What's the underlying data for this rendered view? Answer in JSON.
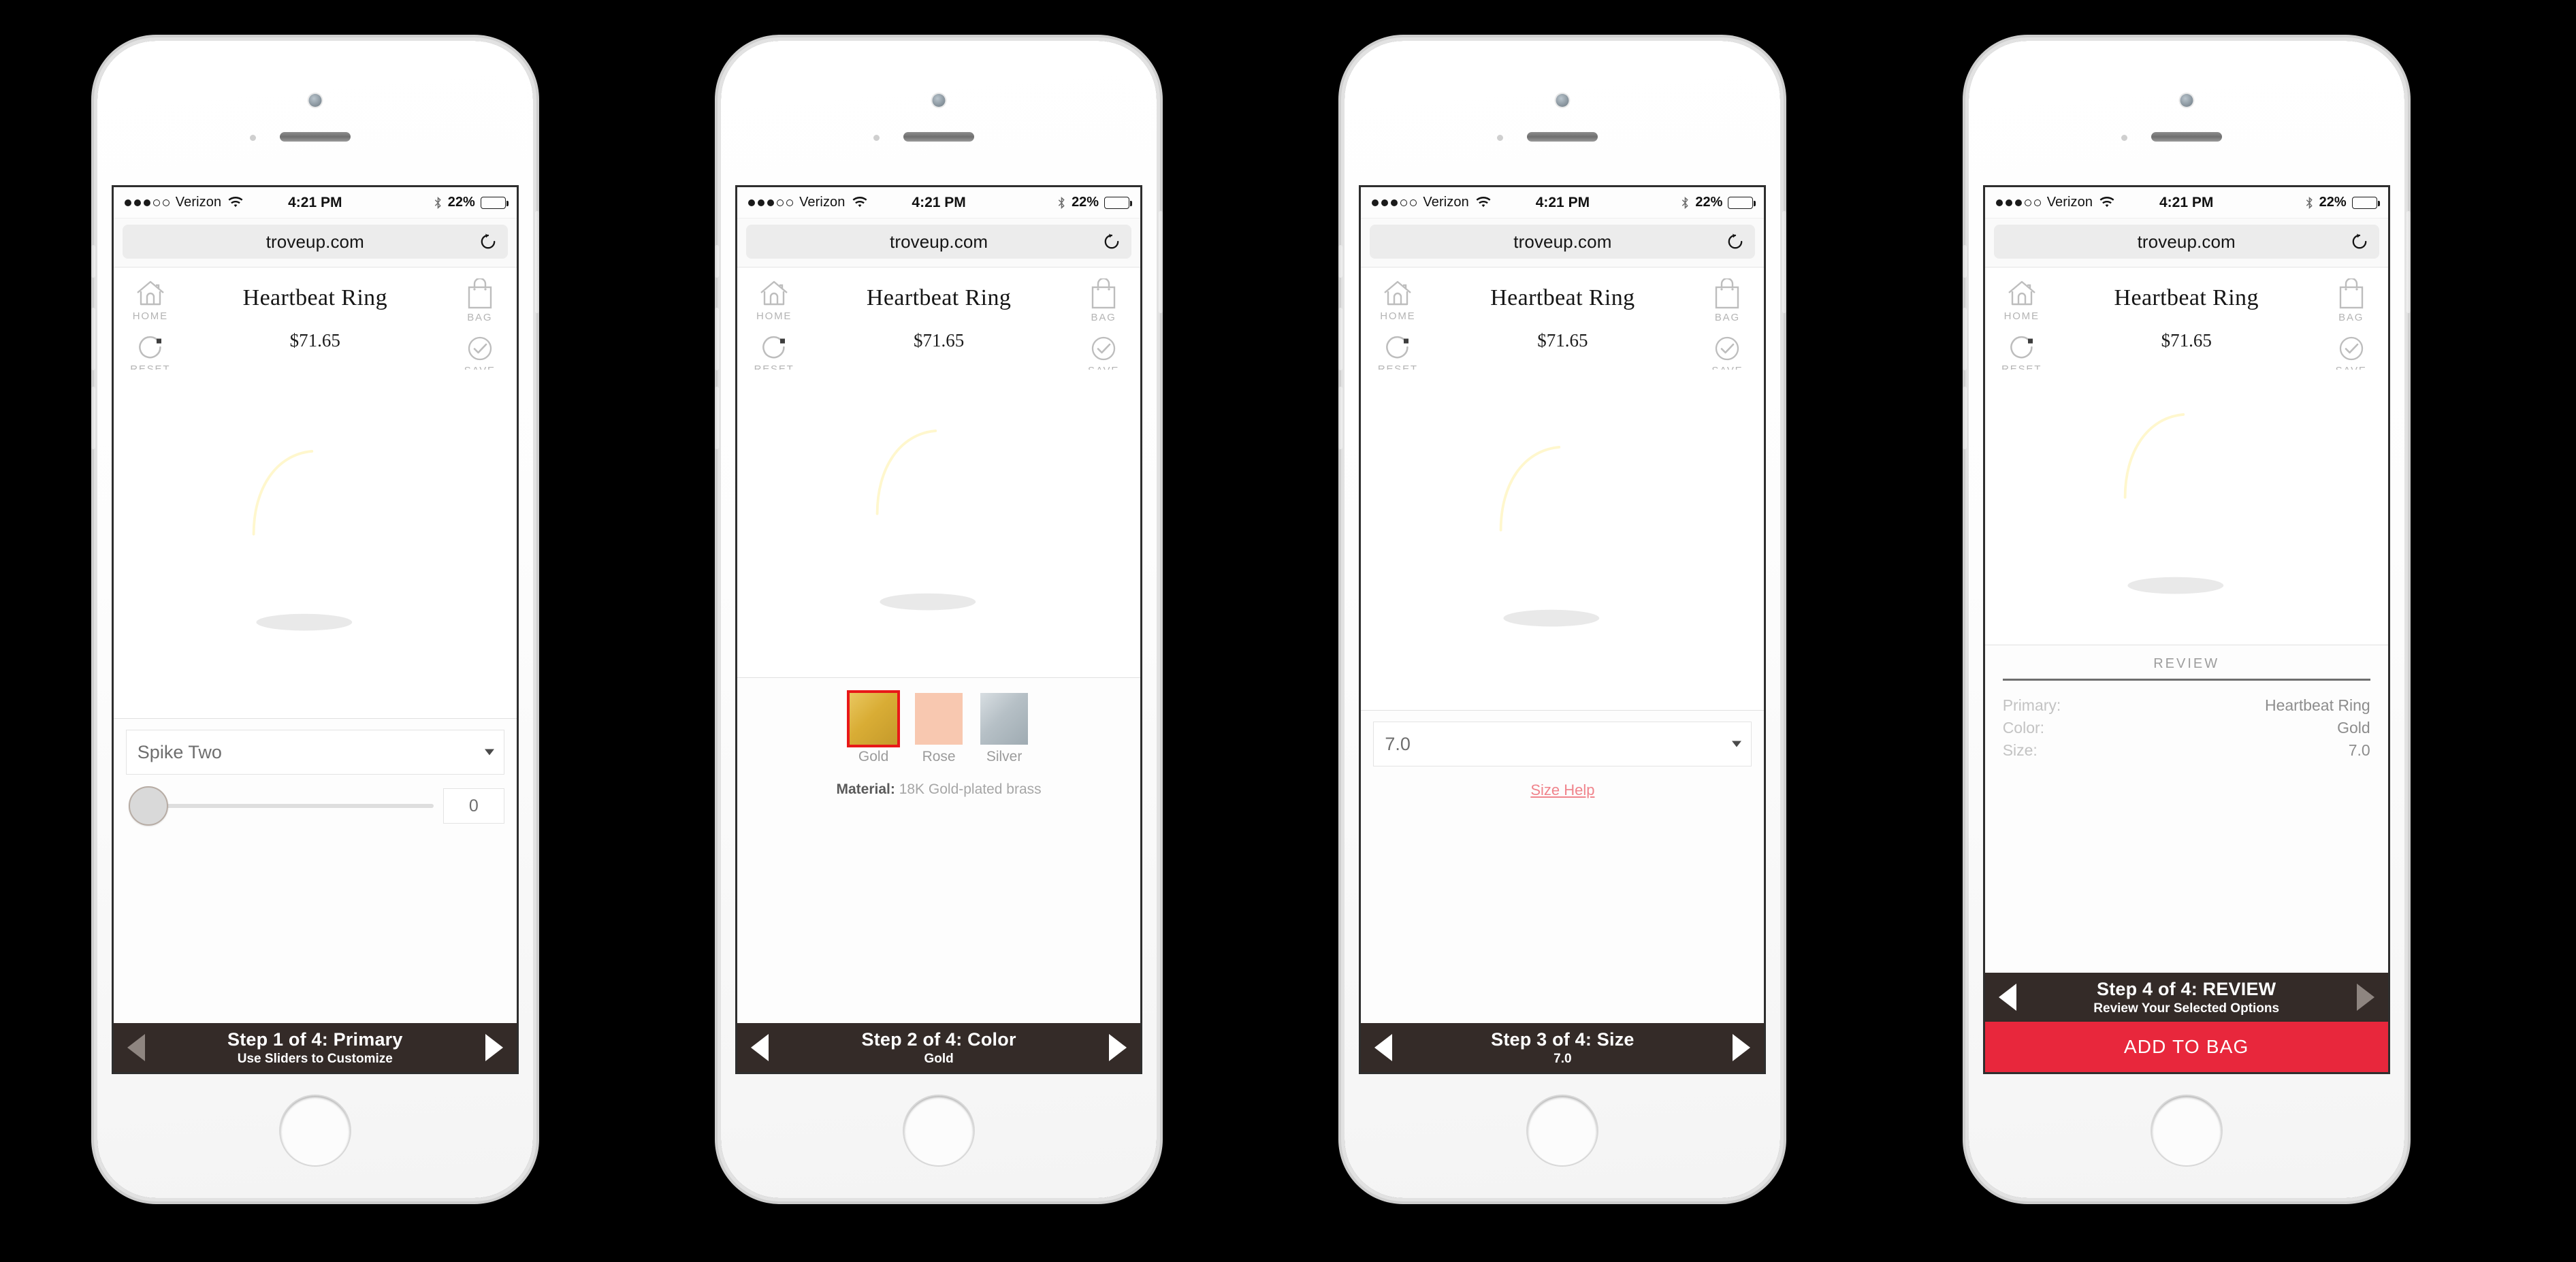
{
  "status_bar": {
    "carrier": "Verizon",
    "signal_dots_filled": 3,
    "signal_dots_total": 5,
    "time": "4:21 PM",
    "battery_percent": "22%",
    "battery_level": 22,
    "bluetooth": true,
    "wifi": true
  },
  "browser": {
    "url": "troveup.com",
    "reload_label": "Reload"
  },
  "app": {
    "home_label": "HOME",
    "bag_label": "BAG",
    "reset_label": "RESET",
    "save_label": "SAVE",
    "product_title": "Heartbeat Ring",
    "product_price": "$71.65"
  },
  "colors": {
    "step_bar_bg": "#342b28",
    "cta_bg": "#e8273c",
    "selected_swatch_outline": "#e81818",
    "size_help_link": "#f0848c",
    "gold": "#d9ad35",
    "rose": "#f8c8b0",
    "silver": "#b6c0c6"
  },
  "screens": [
    {
      "id": "step1",
      "control_type": "slider",
      "select_value": "Spike Two",
      "slider_value": "0",
      "slider_percent": 0,
      "step_main": "Step 1 of 4: Primary",
      "step_sub": "Use Sliders to Customize",
      "prev_enabled": false,
      "next_enabled": true,
      "has_cta": false
    },
    {
      "id": "step2",
      "control_type": "swatches",
      "swatches": [
        {
          "label": "Gold",
          "hex": "#d9ad35",
          "selected": true
        },
        {
          "label": "Rose",
          "hex": "#f8c8b0",
          "selected": false
        },
        {
          "label": "Silver",
          "hex": "#b6c0c6",
          "selected": false
        }
      ],
      "material_label": "Material:",
      "material_value": "18K Gold-plated brass",
      "step_main": "Step 2 of 4: Color",
      "step_sub": "Gold",
      "prev_enabled": true,
      "next_enabled": true,
      "has_cta": false
    },
    {
      "id": "step3",
      "control_type": "size-select",
      "select_value": "7.0",
      "size_help": "Size Help",
      "step_main": "Step 3 of 4: Size",
      "step_sub": "7.0",
      "prev_enabled": true,
      "next_enabled": true,
      "has_cta": false
    },
    {
      "id": "step4",
      "control_type": "review",
      "review_heading": "REVIEW",
      "review_rows": [
        {
          "key": "Primary:",
          "value": "Heartbeat Ring"
        },
        {
          "key": "Color:",
          "value": "Gold"
        },
        {
          "key": "Size:",
          "value": "7.0"
        }
      ],
      "step_main": "Step 4 of 4: REVIEW",
      "step_sub": "Review Your Selected Options",
      "prev_enabled": true,
      "next_enabled": false,
      "has_cta": true,
      "cta_label": "ADD TO BAG"
    }
  ]
}
